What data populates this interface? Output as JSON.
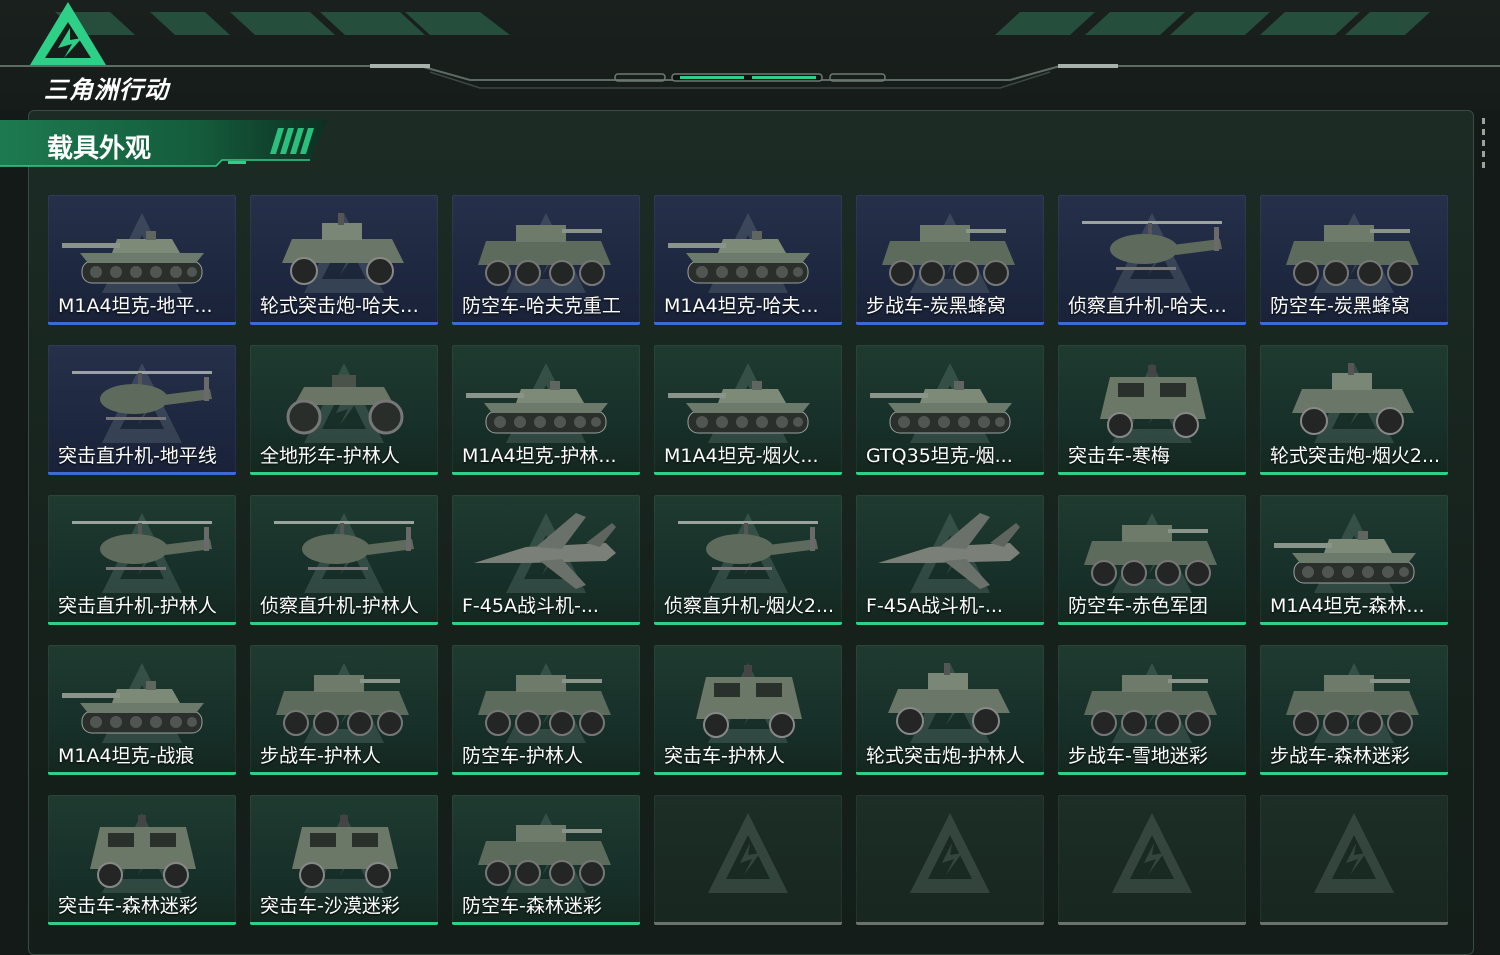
{
  "app": {
    "logo_text": "三角洲行动"
  },
  "section": {
    "title": "载具外观"
  },
  "colors": {
    "accent": "#2ecf86",
    "blue_accent": "#3b6cd6",
    "empty_bar": "#6e726f"
  },
  "grid": {
    "cards": [
      {
        "label": "M1A4坦克-地平...",
        "tier": "blue",
        "icon": "tank-icon"
      },
      {
        "label": "轮式突击炮-哈夫克...",
        "tier": "blue",
        "icon": "wheeled-vehicle-icon"
      },
      {
        "label": "防空车-哈夫克重工",
        "tier": "blue",
        "icon": "apc-icon"
      },
      {
        "label": "M1A4坦克-哈夫...",
        "tier": "blue",
        "icon": "tank-icon"
      },
      {
        "label": "步战车-炭黑蜂窝",
        "tier": "blue",
        "icon": "apc-icon"
      },
      {
        "label": "侦察直升机-哈夫克...",
        "tier": "blue",
        "icon": "helicopter-icon"
      },
      {
        "label": "防空车-炭黑蜂窝",
        "tier": "blue",
        "icon": "apc-icon"
      },
      {
        "label": "突击直升机-地平线",
        "tier": "blue",
        "icon": "helicopter-icon"
      },
      {
        "label": "全地形车-护林人",
        "tier": "green",
        "icon": "atv-icon"
      },
      {
        "label": "M1A4坦克-护林...",
        "tier": "green",
        "icon": "tank-icon"
      },
      {
        "label": "M1A4坦克-烟火...",
        "tier": "green",
        "icon": "tank-icon"
      },
      {
        "label": "GTQ35坦克-烟...",
        "tier": "green",
        "icon": "tank-icon"
      },
      {
        "label": "突击车-寒梅",
        "tier": "green",
        "icon": "truck-icon"
      },
      {
        "label": "轮式突击炮-烟火2...",
        "tier": "green",
        "icon": "wheeled-vehicle-icon"
      },
      {
        "label": "突击直升机-护林人",
        "tier": "green",
        "icon": "helicopter-icon"
      },
      {
        "label": "侦察直升机-护林人",
        "tier": "green",
        "icon": "helicopter-icon"
      },
      {
        "label": "F-45A战斗机-...",
        "tier": "green",
        "icon": "jet-icon"
      },
      {
        "label": "侦察直升机-烟火2...",
        "tier": "green",
        "icon": "helicopter-icon"
      },
      {
        "label": "F-45A战斗机-...",
        "tier": "green",
        "icon": "jet-icon"
      },
      {
        "label": "防空车-赤色军团",
        "tier": "green",
        "icon": "apc-icon"
      },
      {
        "label": "M1A4坦克-森林...",
        "tier": "green",
        "icon": "tank-icon"
      },
      {
        "label": "M1A4坦克-战痕",
        "tier": "green",
        "icon": "tank-icon"
      },
      {
        "label": "步战车-护林人",
        "tier": "green",
        "icon": "apc-icon"
      },
      {
        "label": "防空车-护林人",
        "tier": "green",
        "icon": "apc-icon"
      },
      {
        "label": "突击车-护林人",
        "tier": "green",
        "icon": "truck-icon"
      },
      {
        "label": "轮式突击炮-护林人",
        "tier": "green",
        "icon": "wheeled-vehicle-icon"
      },
      {
        "label": "步战车-雪地迷彩",
        "tier": "green",
        "icon": "apc-icon"
      },
      {
        "label": "步战车-森林迷彩",
        "tier": "green",
        "icon": "apc-icon"
      },
      {
        "label": "突击车-森林迷彩",
        "tier": "green",
        "icon": "truck-icon"
      },
      {
        "label": "突击车-沙漠迷彩",
        "tier": "green",
        "icon": "truck-icon"
      },
      {
        "label": "防空车-森林迷彩",
        "tier": "green",
        "icon": "apc-icon"
      },
      {
        "label": "",
        "tier": "empty",
        "icon": ""
      },
      {
        "label": "",
        "tier": "empty",
        "icon": ""
      },
      {
        "label": "",
        "tier": "empty",
        "icon": ""
      },
      {
        "label": "",
        "tier": "empty",
        "icon": ""
      }
    ]
  }
}
